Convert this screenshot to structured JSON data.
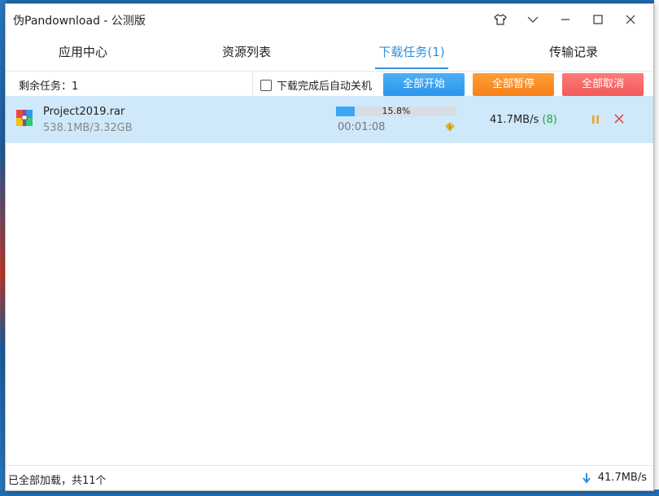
{
  "window": {
    "title": "伪Pandownload - 公测版"
  },
  "tabs": [
    {
      "label": "应用中心"
    },
    {
      "label": "资源列表"
    },
    {
      "label": "下载任务(1)"
    },
    {
      "label": "传输记录"
    }
  ],
  "toolbar": {
    "remaining": "剩余任务：1",
    "auto_shutdown_label": "下载完成后自动关机",
    "start_all": "全部开始",
    "pause_all": "全部暂停",
    "cancel_all": "全部取消"
  },
  "task": {
    "name": "Project2019.rar",
    "size": "538.1MB/3.32GB",
    "progress_text": "15.8%",
    "progress_value": 0.158,
    "elapsed": "00:01:08",
    "speed": "41.7MB/s",
    "connections": "(8)"
  },
  "status": {
    "left": "已全部加载，共11个",
    "speed": "41.7MB/s"
  },
  "colors": {
    "accent": "#2f8fe0",
    "row_selected": "#cfe8fa",
    "start": "#2a95ea",
    "pause": "#f7801c",
    "cancel": "#f25a5a",
    "connections": "#1ea53b",
    "close_x": "#e24c4c"
  }
}
